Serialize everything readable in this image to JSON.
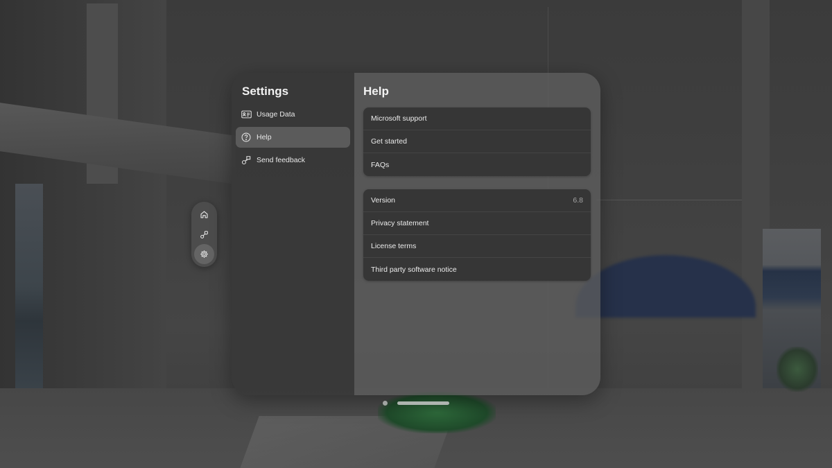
{
  "sidebar": {
    "title": "Settings",
    "items": [
      {
        "label": "Usage Data",
        "icon": "id-card-icon",
        "active": false
      },
      {
        "label": "Help",
        "icon": "help-circle-icon",
        "active": true
      },
      {
        "label": "Send feedback",
        "icon": "feedback-icon",
        "active": false
      }
    ]
  },
  "content": {
    "title": "Help",
    "support_group": [
      {
        "label": "Microsoft support"
      },
      {
        "label": "Get started"
      },
      {
        "label": "FAQs"
      }
    ],
    "info_group": [
      {
        "label": "Version",
        "value": "6.8"
      },
      {
        "label": "Privacy statement"
      },
      {
        "label": "License terms"
      },
      {
        "label": "Third party software notice"
      }
    ]
  },
  "rail": {
    "buttons": [
      {
        "icon": "home-icon",
        "active": false
      },
      {
        "icon": "apps-icon",
        "active": false
      },
      {
        "icon": "gear-icon",
        "active": true
      }
    ]
  },
  "pager": {
    "pages": 2,
    "current": 2
  }
}
